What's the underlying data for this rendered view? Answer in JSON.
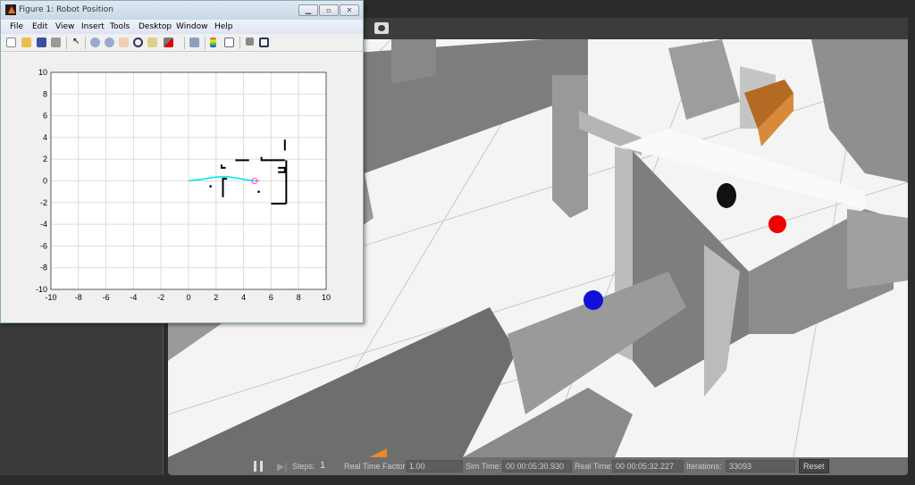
{
  "figure": {
    "title": "Figure 1: Robot Position",
    "menu": [
      "File",
      "Edit",
      "View",
      "Insert",
      "Tools",
      "Desktop",
      "Window",
      "Help"
    ],
    "toolbar_icons": [
      "new-figure-icon",
      "open-icon",
      "save-icon",
      "print-icon",
      "pointer-icon",
      "zoom-in-icon",
      "zoom-out-icon",
      "pan-icon",
      "rotate-3d-icon",
      "data-cursor-icon",
      "brush-icon",
      "link-plot-icon",
      "colorbar-icon",
      "legend-icon",
      "hide-plot-tools-icon",
      "show-plot-tools-icon"
    ]
  },
  "chart_data": {
    "type": "line",
    "xlim": [
      -10,
      10
    ],
    "ylim": [
      -10,
      10
    ],
    "grid": true,
    "xticks": [
      -10,
      -8,
      -6,
      -4,
      -2,
      0,
      2,
      4,
      6,
      8,
      10
    ],
    "yticks": [
      10,
      8,
      6,
      4,
      2,
      0,
      -2,
      -4,
      -6,
      -8,
      -10
    ],
    "series": [
      {
        "name": "robot path",
        "color": "#00e5ee",
        "x": [
          0,
          1,
          2,
          2.7,
          3.5,
          4.2,
          4.8
        ],
        "y": [
          0,
          0.15,
          0.35,
          0.4,
          0.25,
          0.1,
          0
        ]
      },
      {
        "name": "robot position",
        "color": "#ff44cc",
        "x": [
          4.8
        ],
        "y": [
          0
        ]
      }
    ],
    "obstacles": [
      [
        [
          7.0,
          3.8
        ],
        [
          7.0,
          2.8
        ]
      ],
      [
        [
          3.4,
          1.9
        ],
        [
          4.4,
          1.9
        ]
      ],
      [
        [
          5.3,
          2.2
        ],
        [
          5.3,
          1.9
        ],
        [
          7.0,
          1.9
        ]
      ],
      [
        [
          7.1,
          1.9
        ],
        [
          7.1,
          -2.1
        ]
      ],
      [
        [
          6.0,
          -2.1
        ],
        [
          7.1,
          -2.1
        ]
      ],
      [
        [
          2.4,
          1.5
        ],
        [
          2.4,
          1.2
        ],
        [
          2.7,
          1.2
        ]
      ],
      [
        [
          6.5,
          1.2
        ],
        [
          7.0,
          1.2
        ],
        [
          7.0,
          0.8
        ],
        [
          6.5,
          0.8
        ]
      ],
      [
        [
          2.8,
          0.2
        ],
        [
          2.5,
          0.2
        ],
        [
          2.5,
          -1.5
        ]
      ]
    ],
    "points": [
      [
        1.6,
        -0.5
      ],
      [
        5.1,
        -1.0
      ]
    ]
  },
  "gazebo": {
    "steps_label": "Steps:",
    "steps_value": "1",
    "rtf_label": "Real Time Factor:",
    "rtf_value": "1.00",
    "sim_time_label": "Sim Time:",
    "sim_time": "00 00:05:30.930",
    "real_time_label": "Real Time:",
    "real_time": "00 00:05:32.227",
    "iterations_label": "Iterations:",
    "iterations": "33093",
    "reset": "Reset"
  }
}
